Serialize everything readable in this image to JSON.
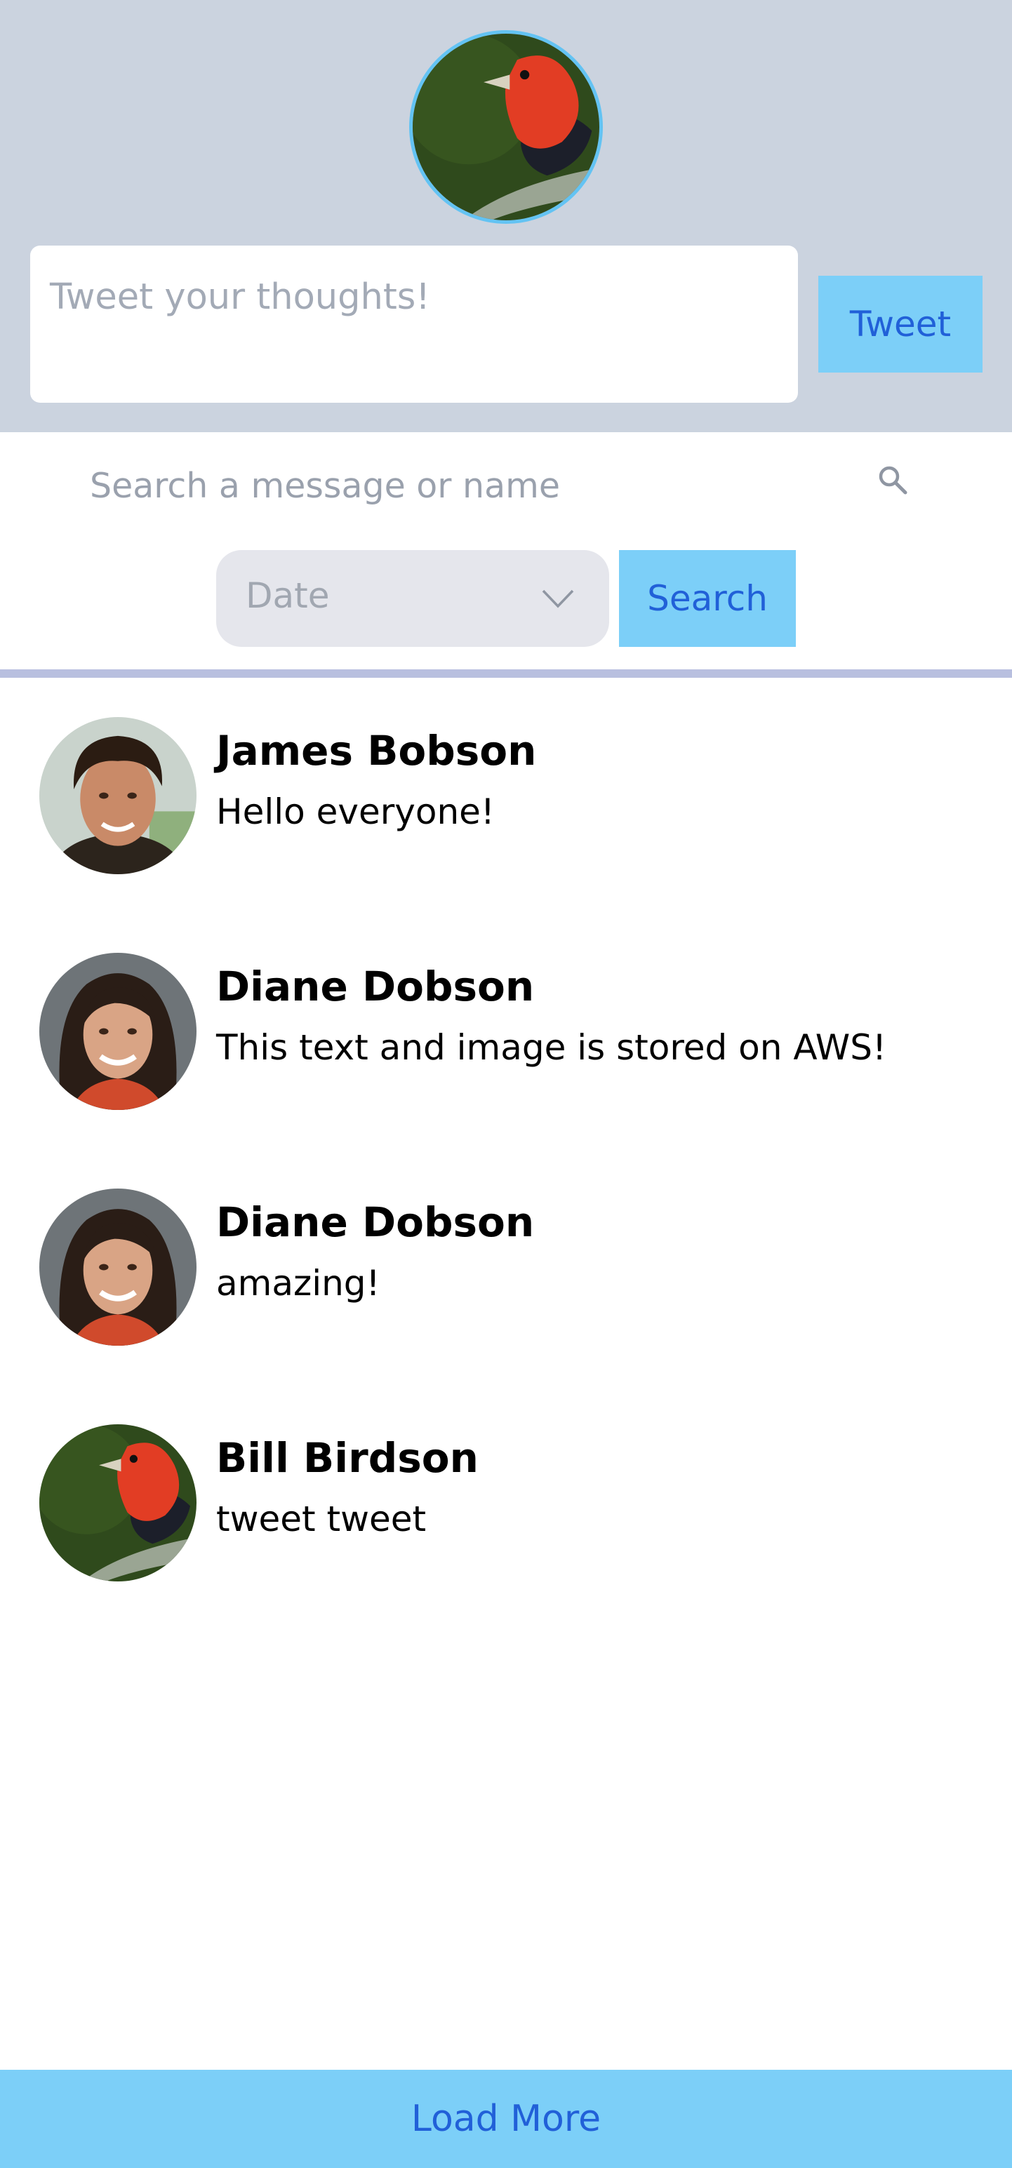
{
  "compose": {
    "avatar_icon": "bird-avatar",
    "placeholder": "Tweet your thoughts!",
    "tweet_label": "Tweet"
  },
  "search": {
    "placeholder": "Search a message or name",
    "icon": "search-icon",
    "sort_value": "Date",
    "search_label": "Search"
  },
  "feed": {
    "items": [
      {
        "author": "James Bobson",
        "text": "Hello everyone!",
        "avatar": "man-portrait"
      },
      {
        "author": "Diane Dobson",
        "text": "This text and image is stored on AWS!",
        "avatar": "woman-portrait"
      },
      {
        "author": "Diane Dobson",
        "text": "amazing!",
        "avatar": "woman-portrait"
      },
      {
        "author": "Bill Birdson",
        "text": "tweet tweet",
        "avatar": "bird-avatar"
      }
    ]
  },
  "load_more_label": "Load More",
  "colors": {
    "header_bg": "#cbd3df",
    "button_bg": "#7ccff8",
    "button_text": "#2160d8",
    "avatar_ring": "#63c3f3",
    "divider": "#b8bfdf"
  }
}
